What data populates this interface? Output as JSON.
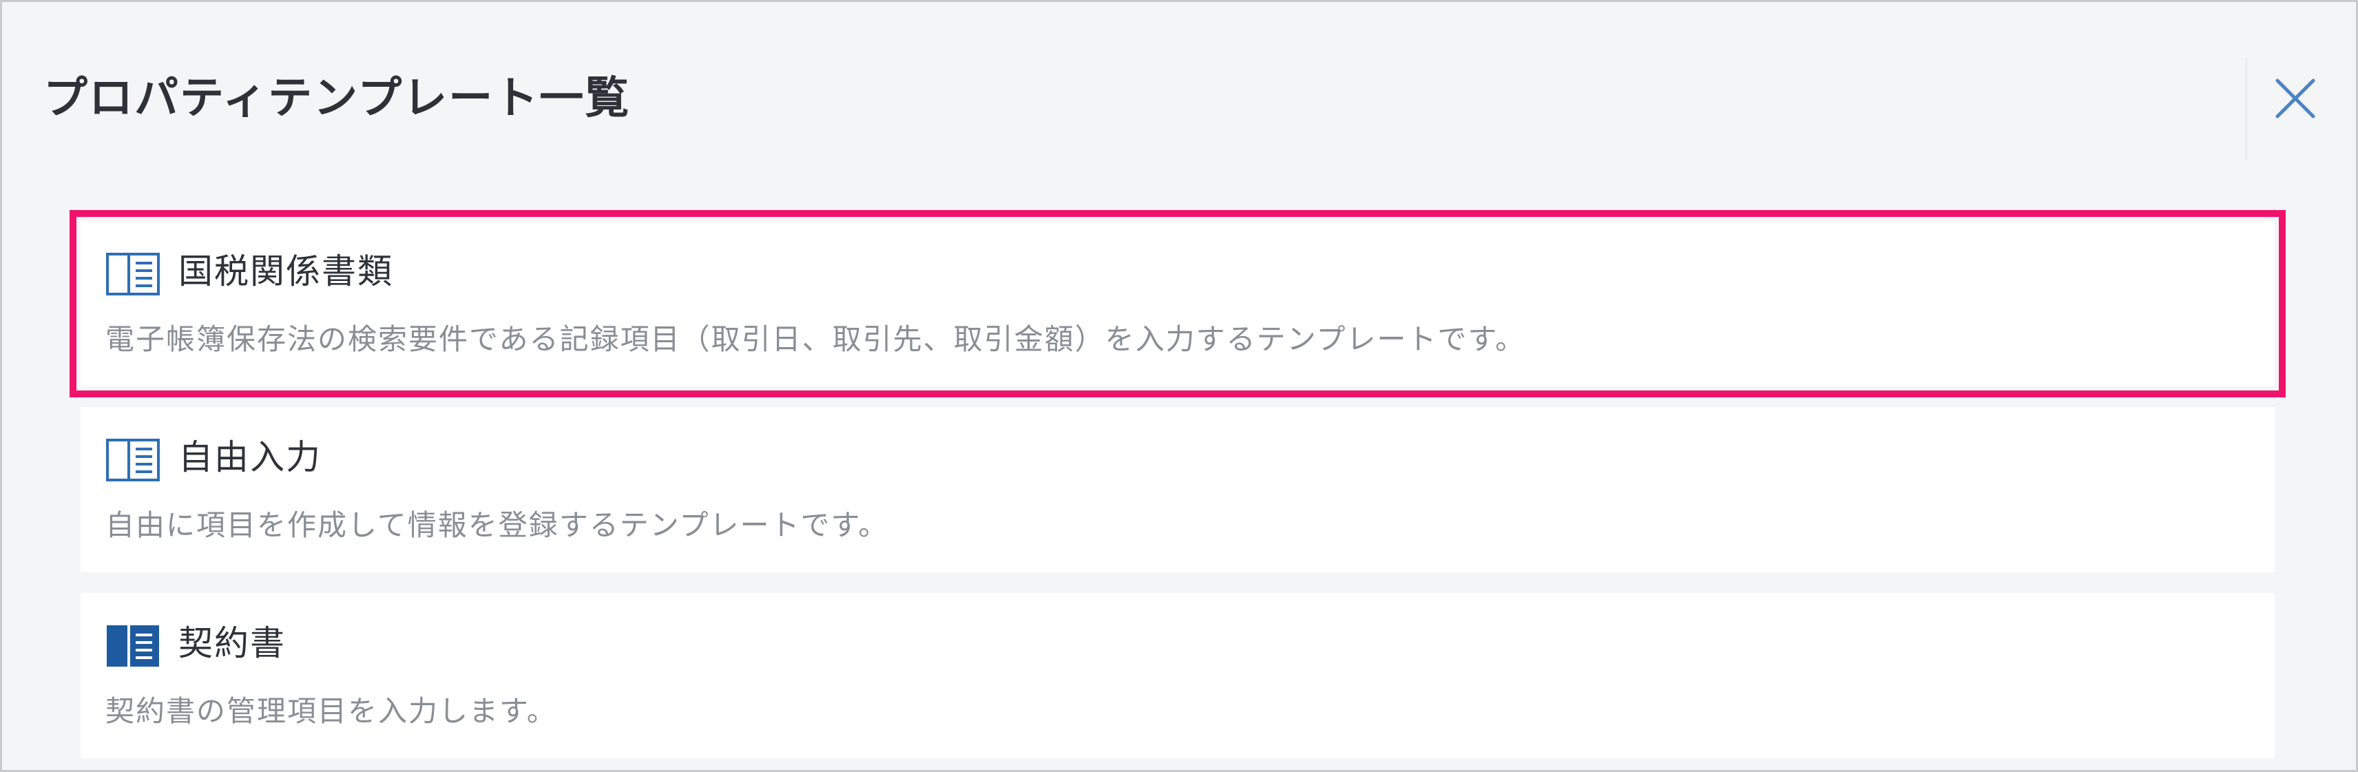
{
  "dialog": {
    "title": "プロパティテンプレート一覧",
    "close_icon": "close-icon"
  },
  "templates": [
    {
      "icon": "book-outline-icon",
      "title": "国税関係書類",
      "description": "電子帳簿保存法の検索要件である記録項目（取引日、取引先、取引金額）を入力するテンプレートです。",
      "selected": true
    },
    {
      "icon": "book-outline-icon",
      "title": "自由入力",
      "description": "自由に項目を作成して情報を登録するテンプレートです。",
      "selected": false
    },
    {
      "icon": "book-filled-icon",
      "title": "契約書",
      "description": "契約書の管理項目を入力します。",
      "selected": false
    }
  ],
  "colors": {
    "background": "#f4f5f7",
    "card": "#ffffff",
    "highlight": "#f0136c",
    "icon": "#2d6fb5",
    "title_text": "#2e3238",
    "desc_text": "#8a8e94"
  }
}
